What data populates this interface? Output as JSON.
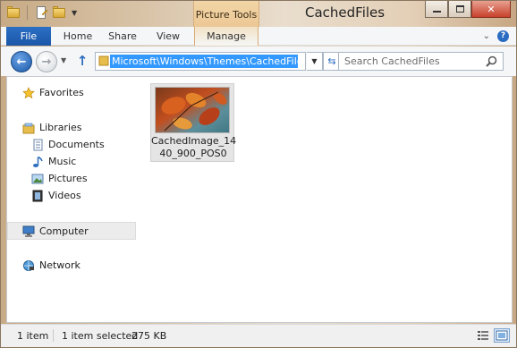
{
  "window": {
    "title": "CachedFiles",
    "context_tab_group": "Picture Tools"
  },
  "ribbon": {
    "file_label": "File",
    "tabs": [
      {
        "label": "Home"
      },
      {
        "label": "Share"
      },
      {
        "label": "View"
      },
      {
        "label": "Manage"
      }
    ]
  },
  "navbar": {
    "address": "Microsoft\\Windows\\Themes\\CachedFiles",
    "search_placeholder": "Search CachedFiles"
  },
  "sidebar": {
    "favorites": "Favorites",
    "libraries": "Libraries",
    "library_items": [
      "Documents",
      "Music",
      "Pictures",
      "Videos"
    ],
    "computer": "Computer",
    "network": "Network"
  },
  "files": [
    {
      "name_line1": "CachedImage_14",
      "name_line2": "40_900_POS0"
    }
  ],
  "status": {
    "item_count": "1 item",
    "selection": "1 item selected",
    "size": "275 KB"
  },
  "colors": {
    "file_tab": "#1b57a8",
    "selection_highlight": "#3399ff",
    "context_tab": "#f2d6a6",
    "close_button": "#c7412c"
  }
}
